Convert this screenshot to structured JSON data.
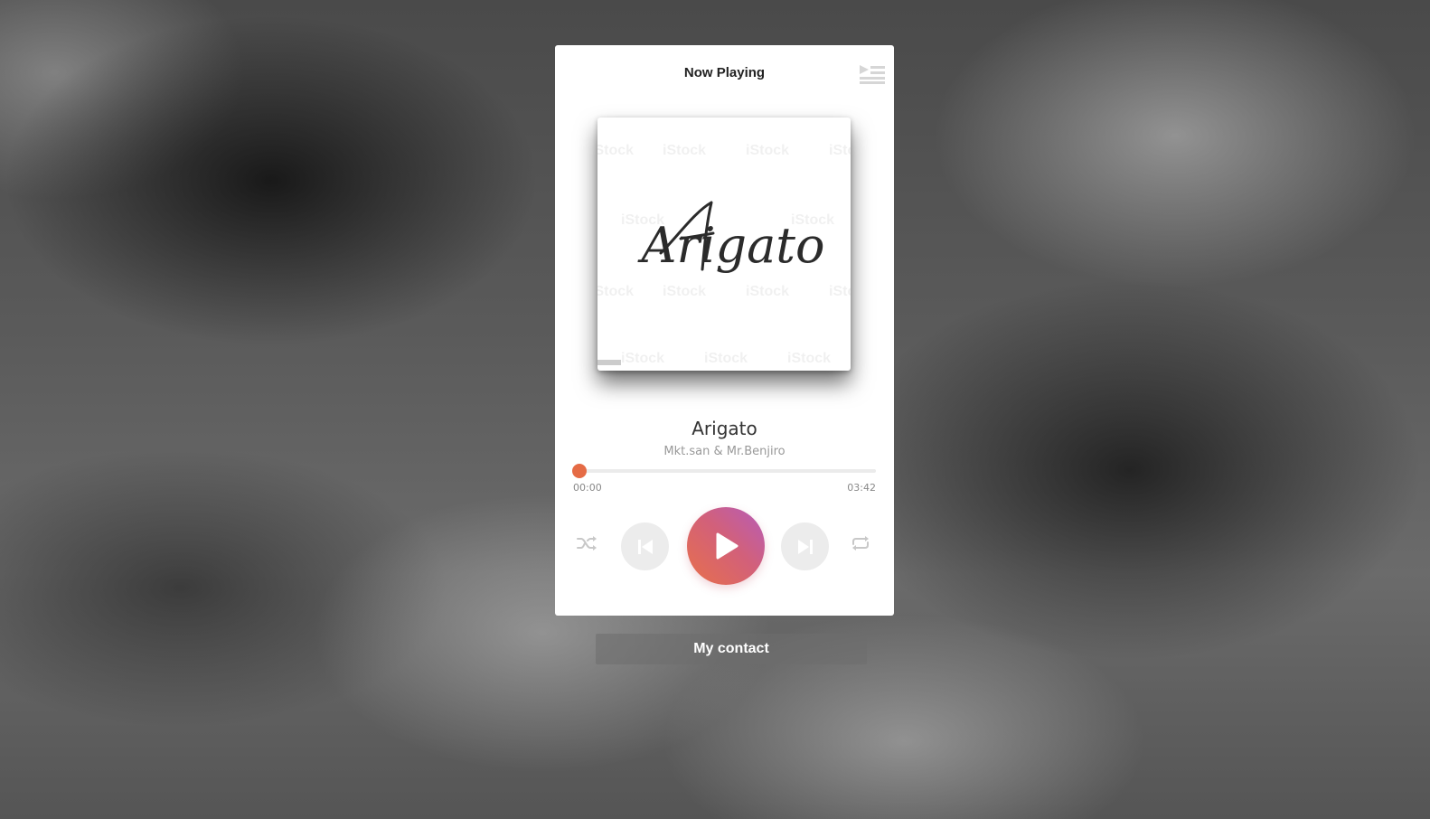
{
  "player": {
    "header_title": "Now Playing",
    "playlist_icon": "playlist-icon",
    "cover": {
      "art_text": "Arigato",
      "watermark_text": "iStock"
    },
    "track": {
      "title": "Arigato",
      "artist": "Mkt.san & Mr.Benjiro"
    },
    "progress": {
      "current_time": "00:00",
      "total_time": "03:42",
      "fraction": 0.02
    },
    "controls": {
      "shuffle_icon": "shuffle-icon",
      "previous_icon": "skip-previous-icon",
      "play_icon": "play-icon",
      "next_icon": "skip-next-icon",
      "repeat_icon": "repeat-icon"
    },
    "colors": {
      "accent": "#e56b45",
      "play_gradient_start": "#e8704a",
      "play_gradient_end": "#b65dba"
    }
  },
  "footer": {
    "contact_label": "My contact"
  }
}
